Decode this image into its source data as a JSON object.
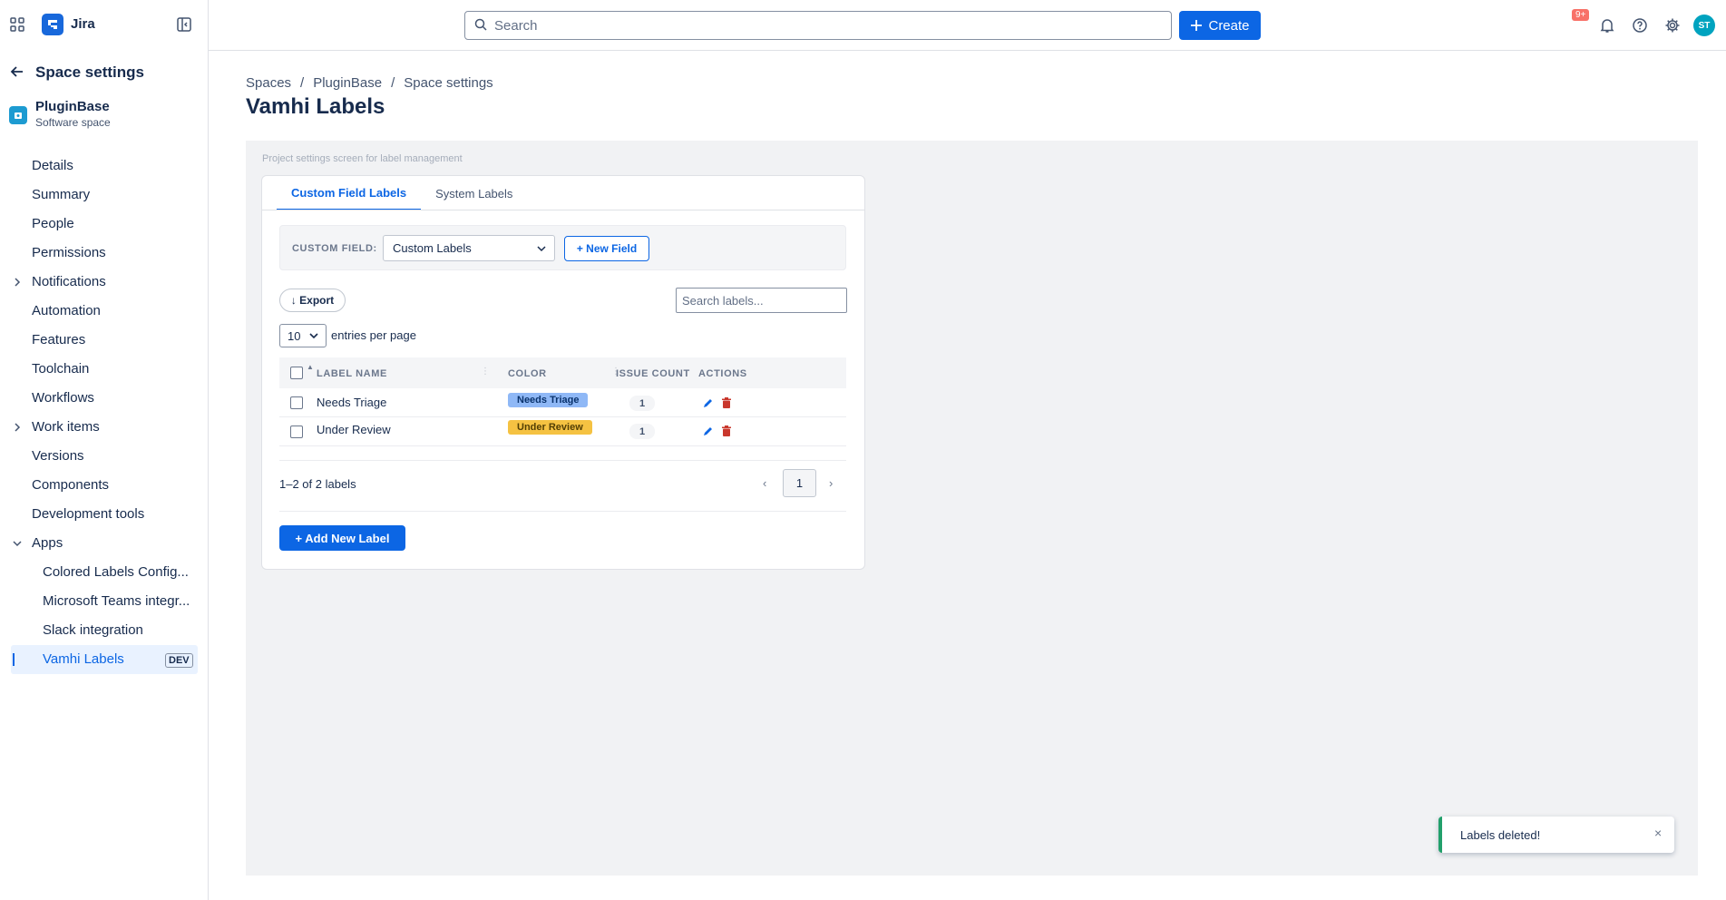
{
  "topbar": {
    "app_name": "Jira",
    "search_placeholder": "Search",
    "create_label": "Create",
    "notification_badge": "9+",
    "avatar_initials": "ST"
  },
  "sidebar": {
    "title": "Space settings",
    "space_name": "PluginBase",
    "space_type": "Software space",
    "items": [
      {
        "label": "Details"
      },
      {
        "label": "Summary"
      },
      {
        "label": "People"
      },
      {
        "label": "Permissions"
      },
      {
        "label": "Notifications"
      },
      {
        "label": "Automation"
      },
      {
        "label": "Features"
      },
      {
        "label": "Toolchain"
      },
      {
        "label": "Workflows"
      },
      {
        "label": "Work items"
      },
      {
        "label": "Versions"
      },
      {
        "label": "Components"
      },
      {
        "label": "Development tools"
      },
      {
        "label": "Apps"
      }
    ],
    "apps": [
      {
        "label": "Colored Labels Config..."
      },
      {
        "label": "Microsoft Teams integr..."
      },
      {
        "label": "Slack integration"
      },
      {
        "label": "Vamhi Labels",
        "badge": "DEV"
      }
    ]
  },
  "breadcrumb": [
    "Spaces",
    "PluginBase",
    "Space settings"
  ],
  "page_title": "Vamhi Labels",
  "app": {
    "hint": "Project settings screen for label management",
    "tabs": [
      "Custom Field Labels",
      "System Labels"
    ],
    "custom_field_label": "CUSTOM FIELD:",
    "custom_field_value": "Custom Labels",
    "new_field_label": "+ New Field",
    "export_label": "↓ Export",
    "search_placeholder": "Search labels...",
    "entries_value": "10",
    "entries_text": "entries per page",
    "columns": [
      "LABEL NAME",
      "COLOR",
      "ISSUE COUNT",
      "ACTIONS"
    ],
    "rows": [
      {
        "name": "Needs Triage",
        "chip": "Needs Triage",
        "chip_bg": "#8fb8f6",
        "chip_fg": "#09326c",
        "count": "1"
      },
      {
        "name": "Under Review",
        "chip": "Under Review",
        "chip_bg": "#f5c242",
        "chip_fg": "#533f04",
        "count": "1"
      }
    ],
    "range_text": "1–2 of 2 labels",
    "page": "1",
    "add_label": "+ Add New Label"
  },
  "toast": {
    "text": "Labels deleted!",
    "close": "×"
  },
  "colors": {
    "accent": "#0c66e4",
    "delete": "#c9372c",
    "success": "#22a06b"
  }
}
